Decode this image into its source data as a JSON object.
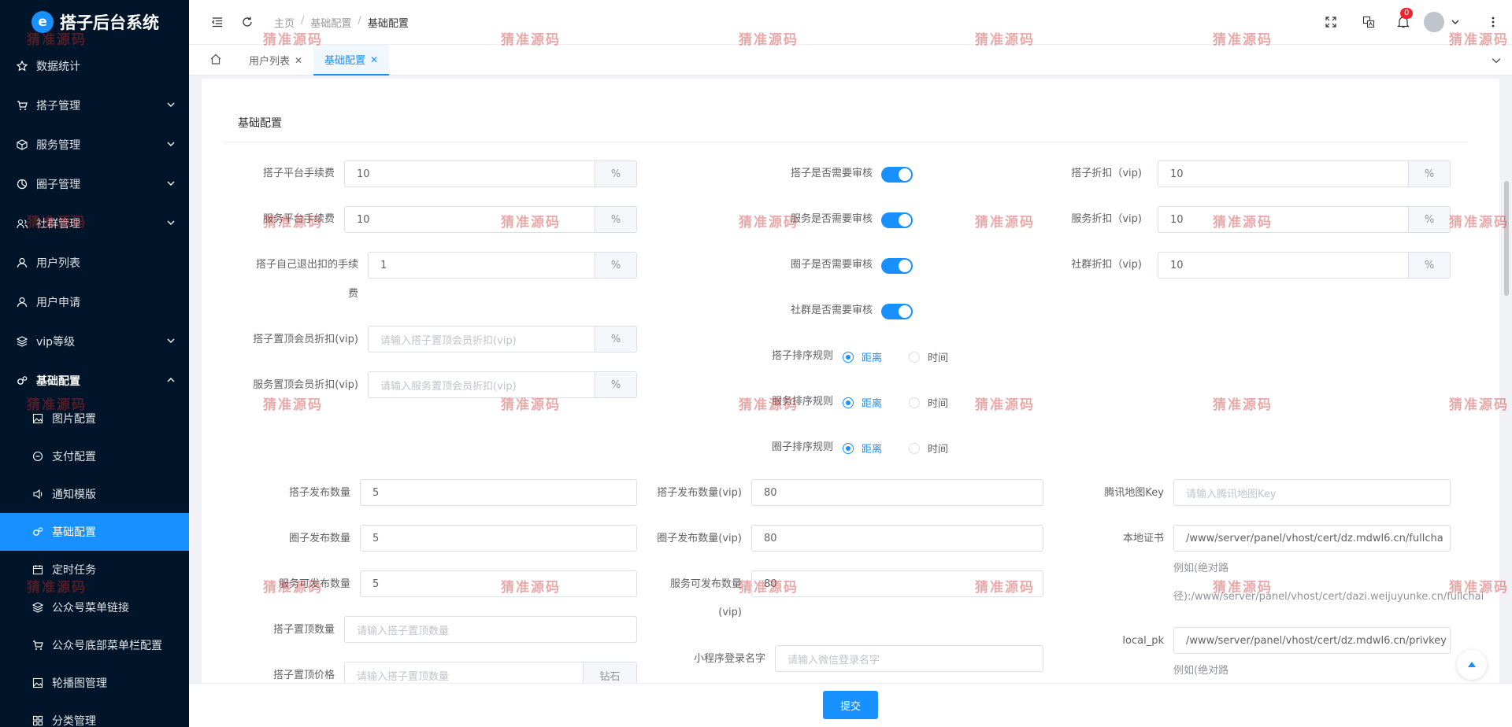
{
  "app": {
    "title": "搭子后台系统",
    "logo_letter": "e"
  },
  "sidebar": {
    "items": [
      {
        "label": "数据统计",
        "icon": "star-icon"
      },
      {
        "label": "搭子管理",
        "icon": "cart-icon"
      },
      {
        "label": "服务管理",
        "icon": "cube-icon"
      },
      {
        "label": "圈子管理",
        "icon": "pie-icon"
      },
      {
        "label": "社群管理",
        "icon": "group-icon"
      },
      {
        "label": "用户列表",
        "icon": "user-icon"
      },
      {
        "label": "用户申请",
        "icon": "user-icon"
      },
      {
        "label": "vip等级",
        "icon": "layers-icon"
      },
      {
        "label": "基础配置",
        "icon": "gears-icon"
      }
    ],
    "sub_items": [
      {
        "label": "图片配置",
        "icon": "image-icon"
      },
      {
        "label": "支付配置",
        "icon": "circle-minus-icon"
      },
      {
        "label": "通知模版",
        "icon": "sound-icon"
      },
      {
        "label": "基础配置",
        "icon": "gears-icon"
      },
      {
        "label": "定时任务",
        "icon": "calendar-icon"
      },
      {
        "label": "公众号菜单链接",
        "icon": "layers-icon"
      },
      {
        "label": "公众号底部菜单栏配置",
        "icon": "cart-icon"
      },
      {
        "label": "轮播图管理",
        "icon": "image-icon"
      },
      {
        "label": "分类管理",
        "icon": "grid-icon"
      }
    ]
  },
  "header": {
    "breadcrumb": [
      "主页",
      "基础配置",
      "基础配置"
    ],
    "notification_count": "0"
  },
  "tabs": [
    {
      "label": "用户列表"
    },
    {
      "label": "基础配置"
    }
  ],
  "watermark": "猜准源码",
  "form": {
    "section_title": "基础配置",
    "col1": [
      {
        "label": "搭子平台手续费",
        "value": "10",
        "unit": "%"
      },
      {
        "label": "服务平台手续费",
        "value": "10",
        "unit": "%"
      },
      {
        "label": "搭子自己退出扣的手续",
        "label2": "费",
        "value": "1",
        "unit": "%"
      },
      {
        "label": "搭子置顶会员折扣(vip)",
        "placeholder": "请输入搭子置顶会员折扣(vip)",
        "unit": "%"
      },
      {
        "label": "服务置顶会员折扣(vip)",
        "placeholder": "请输入服务置顶会员折扣(vip)",
        "unit": "%"
      }
    ],
    "switches": [
      {
        "label": "搭子是否需要审核",
        "on": true
      },
      {
        "label": "服务是否需要审核",
        "on": true
      },
      {
        "label": "圈子是否需要审核",
        "on": true
      },
      {
        "label": "社群是否需要审核",
        "on": true
      }
    ],
    "sort_rules": [
      {
        "label": "搭子排序规则",
        "options": [
          "距离",
          "时间"
        ],
        "selected": "距离"
      },
      {
        "label": "服务排序规则",
        "options": [
          "距离",
          "时间"
        ],
        "selected": "距离"
      },
      {
        "label": "圈子排序规则",
        "options": [
          "距离",
          "时间"
        ],
        "selected": "距离"
      }
    ],
    "col3": [
      {
        "label": "搭子折扣（vip)",
        "value": "10",
        "unit": "%"
      },
      {
        "label": "服务折扣（vip)",
        "value": "10",
        "unit": "%"
      },
      {
        "label": "社群折扣（vip)",
        "value": "10",
        "unit": "%"
      }
    ],
    "publish": {
      "col1": [
        {
          "label": "搭子发布数量",
          "value": "5"
        },
        {
          "label": "圈子发布数量",
          "value": "5"
        },
        {
          "label": "服务可发布数量",
          "value": "5"
        },
        {
          "label": "搭子置顶数量",
          "placeholder": "请输入搭子置顶数量"
        },
        {
          "label": "搭子置顶价格",
          "placeholder": "请输入搭子置顶数量",
          "unit": "钻石"
        }
      ],
      "col2": [
        {
          "label": "搭子发布数量(vip)",
          "value": "80"
        },
        {
          "label": "圈子发布数量(vip)",
          "value": "80"
        },
        {
          "label": "服务可发布数量",
          "label2": "(vip)",
          "value": "80"
        },
        {
          "label": "小程序登录名字",
          "placeholder": "请输入微信登录名字"
        }
      ],
      "col3": [
        {
          "label": "腾讯地图Key",
          "placeholder": "请输入腾讯地图Key"
        },
        {
          "label": "本地证书",
          "value": "/www/server/panel/vhost/cert/dz.mdwl6.cn/fullcha",
          "hint1": "例如(绝对路",
          "hint2": "径):/www/server/panel/vhost/cert/dazi.weijuyunke.cn/fullchai"
        },
        {
          "label": "local_pk",
          "value": "/www/server/panel/vhost/cert/dz.mdwl6.cn/privkey",
          "hint1": "例如(绝对路"
        }
      ]
    },
    "submit_label": "提交"
  }
}
